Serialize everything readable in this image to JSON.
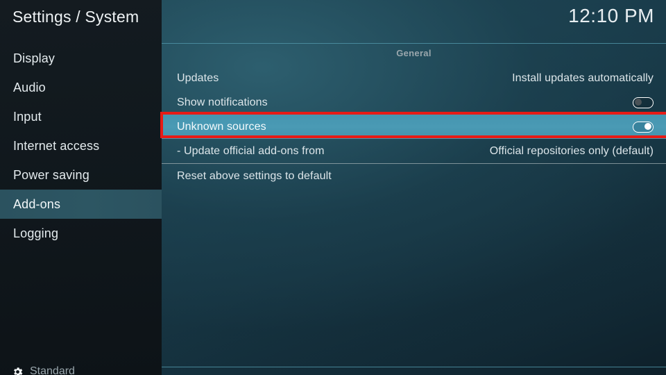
{
  "window": {
    "title": "Settings / System",
    "clock": "12:10 PM"
  },
  "colors": {
    "accent_teal": "#4595b0",
    "sidebar_selected": "#2d5663",
    "annotation_red": "#e61b16",
    "separator": "#4f93a6",
    "row_divider": "#9fadb2"
  },
  "sidebar": {
    "items": [
      {
        "label": "Display",
        "selected": false
      },
      {
        "label": "Audio",
        "selected": false
      },
      {
        "label": "Input",
        "selected": false
      },
      {
        "label": "Internet access",
        "selected": false
      },
      {
        "label": "Power saving",
        "selected": false
      },
      {
        "label": "Add-ons",
        "selected": true
      },
      {
        "label": "Logging",
        "selected": false
      }
    ],
    "footer": {
      "icon": "gear-icon",
      "label": "Standard"
    }
  },
  "settings": {
    "group_header": "General",
    "rows": [
      {
        "label": "Updates",
        "value": "Install updates automatically",
        "control": "text",
        "highlighted": false
      },
      {
        "label": "Show notifications",
        "value": "",
        "control": "toggle-off",
        "highlighted": false
      },
      {
        "label": "Unknown sources",
        "value": "",
        "control": "toggle-on",
        "highlighted": true
      },
      {
        "label": "- Update official add-ons from",
        "value": "Official repositories only (default)",
        "control": "text",
        "highlighted": false
      },
      {
        "label": "Reset above settings to default",
        "value": "",
        "control": "none",
        "highlighted": false
      }
    ]
  },
  "annotation": {
    "type": "red-highlight-box",
    "targets_row": "Unknown sources"
  }
}
